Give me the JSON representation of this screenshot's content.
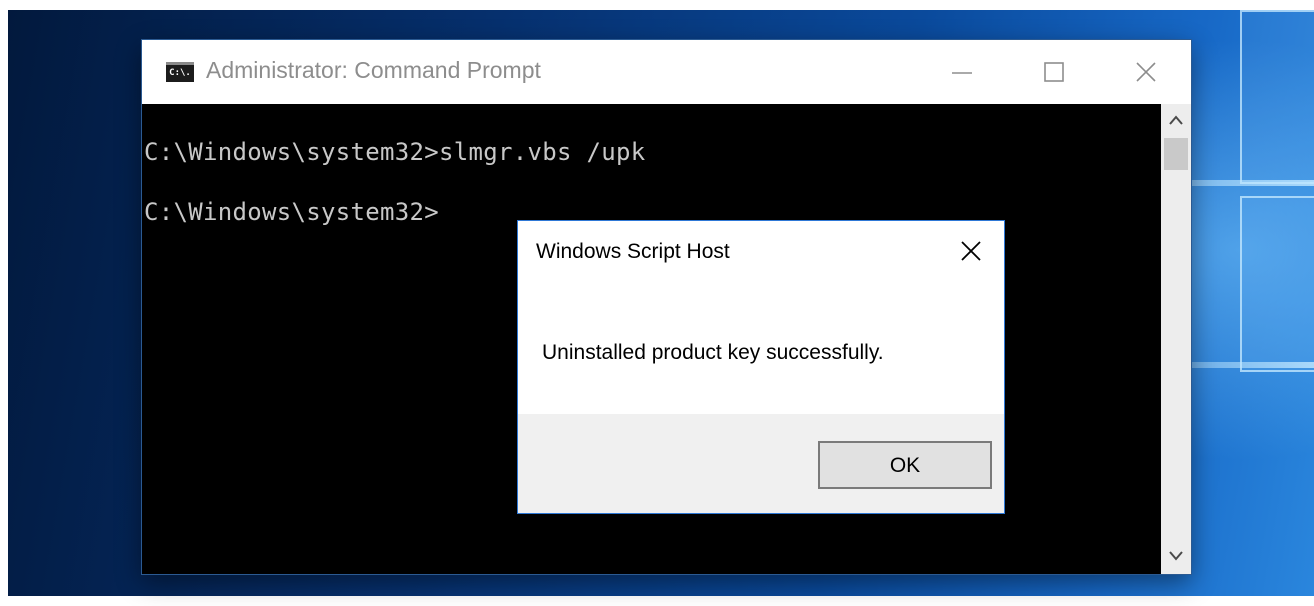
{
  "cmd_window": {
    "title": "Administrator: Command Prompt",
    "icon_name": "cmd-app-icon",
    "icon_text": "C:\\.",
    "controls": {
      "minimize_icon": "minimize-icon",
      "maximize_icon": "maximize-icon",
      "close_icon": "close-icon"
    },
    "lines": [
      "C:\\Windows\\system32>slmgr.vbs /upk",
      "C:\\Windows\\system32>"
    ],
    "colors": {
      "background": "#000000",
      "text": "#c8c8c8"
    }
  },
  "dialog": {
    "title": "Windows Script Host",
    "message": "Uninstalled product key successfully.",
    "ok_label": "OK",
    "close_icon": "close-icon",
    "accent_border": "#2e78d6"
  }
}
